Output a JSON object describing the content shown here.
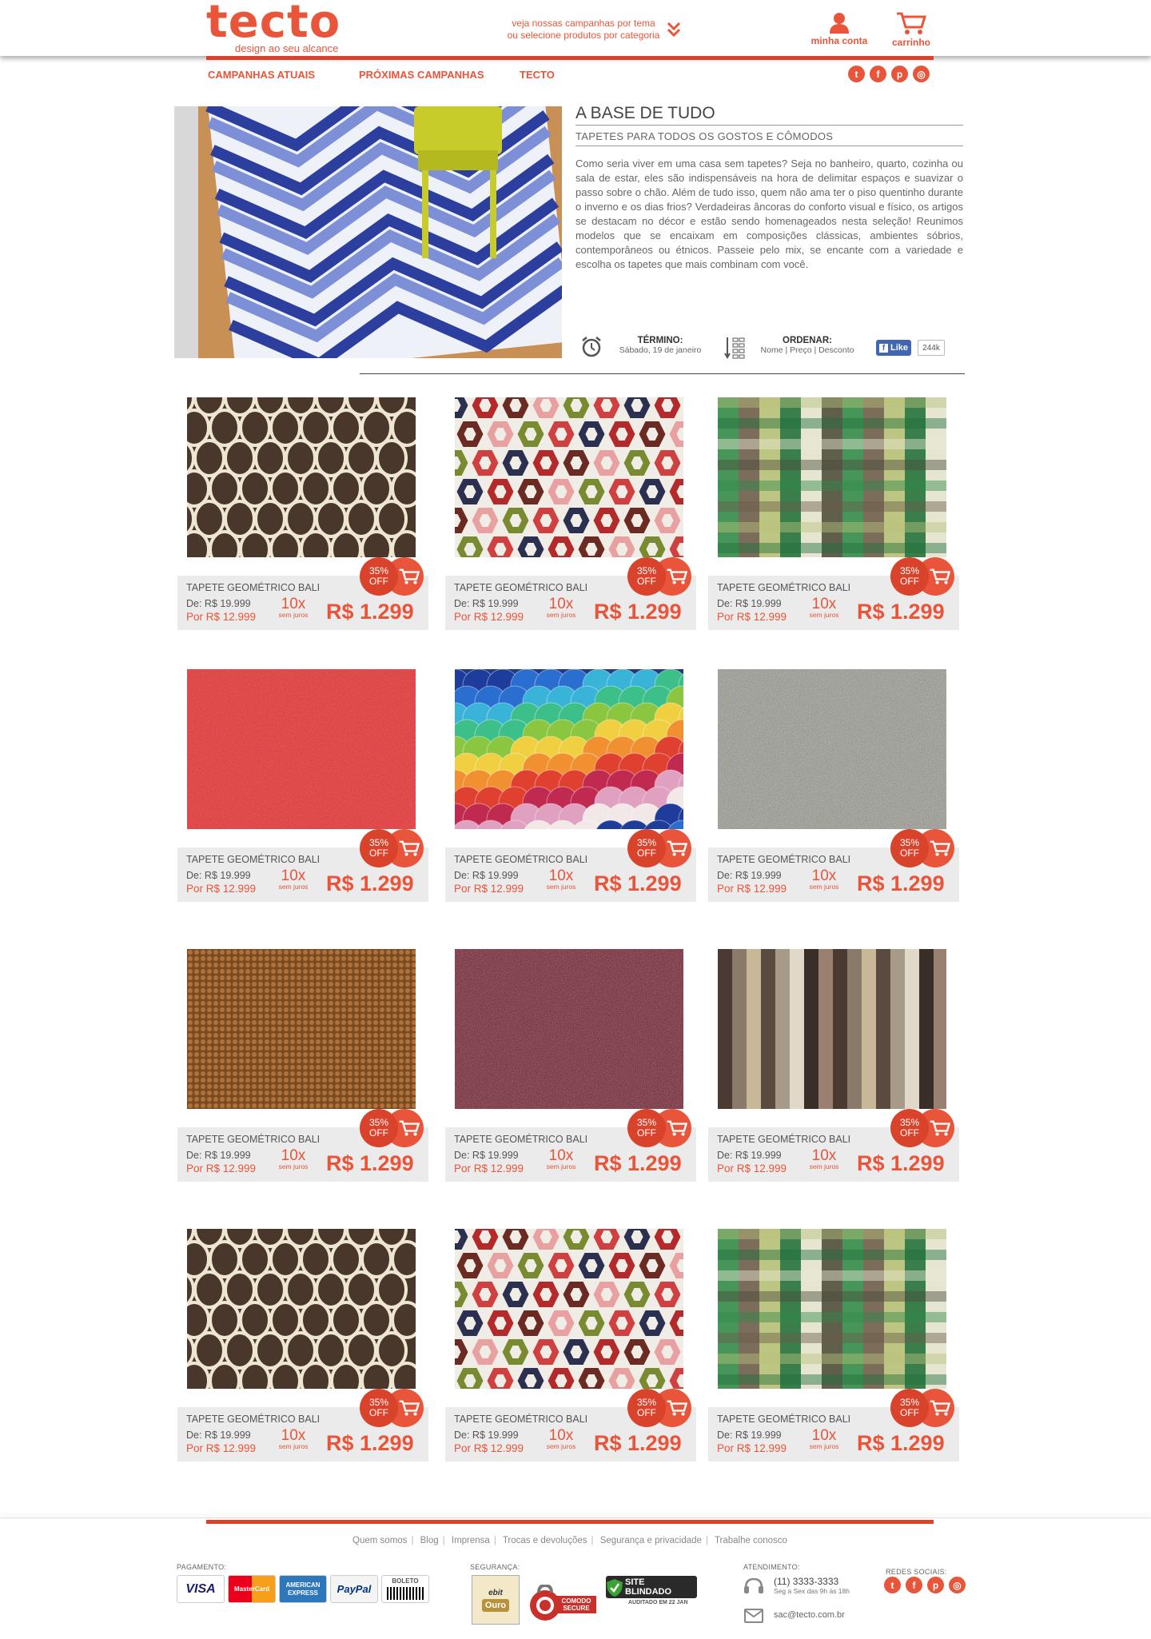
{
  "header": {
    "logo": "tecto",
    "tagline": "design ao seu alcance",
    "campaign_hint_line1": "veja nossas campanhas por tema",
    "campaign_hint_line2": "ou selecione produtos por categoria",
    "account_label": "minha conta",
    "cart_label": "carrinho"
  },
  "nav": {
    "items": [
      {
        "label": "CAMPANHAS ATUAIS"
      },
      {
        "label": "PRÓXIMAS CAMPANHAS"
      },
      {
        "label": "TECTO"
      }
    ],
    "social_icons": [
      "twitter-icon",
      "facebook-icon",
      "pinterest-icon",
      "instagram-icon"
    ]
  },
  "hero": {
    "title": "A BASE DE TUDO",
    "subtitle": "TAPETES PARA TODOS OS GOSTOS E CÔMODOS",
    "text": "Como seria viver em uma casa sem tapetes? Seja no banheiro, quarto, cozinha ou sala de estar, eles são indispensáveis na hora de delimitar espaços e suavizar o passo sobre o chão. Além de tudo isso, quem não ama ter o piso quentinho durante o inverno e os dias frios? Verdadeiras âncoras do conforto visual e físico, os artigos se destacam no décor e estão sendo homenageados nesta seleção! Reunimos modelos que se encaixam em composições clássicas, ambientes sóbrios, contemporâneos ou étnicos. Passeie pelo mix, se encante com a variedade e escolha os tapetes que mais combinam com você.",
    "end_label": "TÉRMINO:",
    "end_date": "Sábado, 19 de janeiro",
    "order_label": "ORDENAR:",
    "order_options": "Nome | Preço | Desconto",
    "like_label": "Like",
    "like_count": "244k"
  },
  "product_common": {
    "name": "TAPETE GEOMÉTRICO BALI",
    "from_price": "De: R$ 19.999",
    "by_price": "Por R$ 12.999",
    "installments": "10x",
    "installments_note": "sem juros",
    "price": "R$ 1.299",
    "discount_pct": "35%",
    "discount_off": "OFF"
  },
  "products": [
    {
      "pattern": "trellis-brown"
    },
    {
      "pattern": "hexagon-multicolor"
    },
    {
      "pattern": "plaid-green"
    },
    {
      "pattern": "shag-red"
    },
    {
      "pattern": "scales-rainbow"
    },
    {
      "pattern": "shag-gray"
    },
    {
      "pattern": "sisal-brown"
    },
    {
      "pattern": "shag-maroon"
    },
    {
      "pattern": "stripes-beige"
    },
    {
      "pattern": "trellis-brown"
    },
    {
      "pattern": "hexagon-multicolor"
    },
    {
      "pattern": "plaid-green"
    }
  ],
  "footer": {
    "links": [
      "Quem somos",
      "Blog",
      "Imprensa",
      "Trocas e devoluções",
      "Segurança e privacidade",
      "Trabalhe conosco"
    ],
    "payment_title": "PAGAMENTO:",
    "payment_methods": [
      "VISA",
      "MasterCard",
      "AMERICAN EXPRESS",
      "PayPal",
      "BOLETO"
    ],
    "security_title": "SEGURANÇA:",
    "seal_ebit": "ebit",
    "seal_ebit_level": "Ouro",
    "seal_comodo": "COMODO SECURE",
    "seal_blindado": "SITE BLINDADO",
    "seal_blindado_note": "AUDITADO EM 22 JAN",
    "support_title": "ATENDIMENTO:",
    "phone": "(11) 3333-3333",
    "phone_hours": "Seg a Sex das 9h às 18h",
    "email": "sac@tecto.com.br",
    "social_title": "REDES SOCIAIS:"
  },
  "colors": {
    "accent": "#e8553a",
    "accent_dark": "#d9432b",
    "card_bg": "#ebebeb"
  }
}
